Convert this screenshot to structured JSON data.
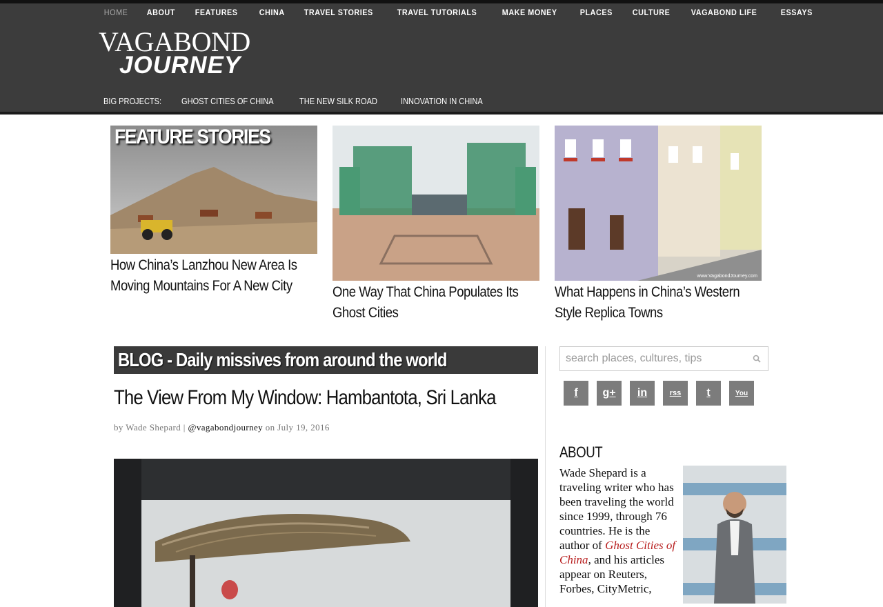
{
  "topnav": [
    {
      "label": "HOME"
    },
    {
      "label": "ABOUT"
    },
    {
      "label": "FEATURES"
    },
    {
      "label": "CHINA"
    },
    {
      "label": "TRAVEL STORIES"
    },
    {
      "label": "TRAVEL TUTORIALS"
    },
    {
      "label": "MAKE MONEY"
    },
    {
      "label": "PLACES"
    },
    {
      "label": "CULTURE"
    },
    {
      "label": "VAGABOND LIFE"
    },
    {
      "label": "ESSAYS"
    }
  ],
  "logo": {
    "line1": "VAGABOND",
    "line2": "JOURNEY"
  },
  "big_projects": {
    "label": "BIG PROJECTS:",
    "items": [
      "GHOST CITIES OF CHINA",
      "THE NEW SILK ROAD",
      "INNOVATION IN CHINA"
    ]
  },
  "features": {
    "label": "FEATURE STORIES",
    "items": [
      {
        "title": "How China’s Lanzhou New Area Is Moving Mountains For A New City"
      },
      {
        "title": "One Way That China Populates Its Ghost Cities"
      },
      {
        "title": "What Happens in China’s Western Style Replica Towns",
        "watermark": "www.VagabondJourney.com"
      }
    ]
  },
  "blog": {
    "heading": "BLOG - Daily missives from around the world",
    "post_title": "The View From My Window: Hambantota, Sri Lanka",
    "byline_prefix": "by Wade Shepard |",
    "byline_handle": "@vagabondjourney",
    "byline_date": "on July 19, 2016"
  },
  "sidebar": {
    "search_placeholder": "search places, cultures, tips",
    "social": [
      {
        "icon": "facebook-icon",
        "glyph": "f"
      },
      {
        "icon": "google-plus-icon",
        "glyph": "g+"
      },
      {
        "icon": "linkedin-icon",
        "glyph": "in"
      },
      {
        "icon": "rss-icon",
        "glyph": "rss"
      },
      {
        "icon": "twitter-icon",
        "glyph": "t"
      },
      {
        "icon": "youtube-icon",
        "glyph": "You"
      }
    ],
    "about_heading": "ABOUT",
    "about_text_1": "Wade Shepard is a traveling writer who has been traveling the world since 1999, through 76 countries. He is the author of ",
    "about_book": "Ghost Cities of China",
    "about_text_2": ", and his articles appear on Reuters, Forbes, CityMetric,"
  },
  "colors": {
    "header_bg": "#3c3c3c",
    "link_red": "#b71c1c",
    "social_bg": "#7c7c7c"
  }
}
